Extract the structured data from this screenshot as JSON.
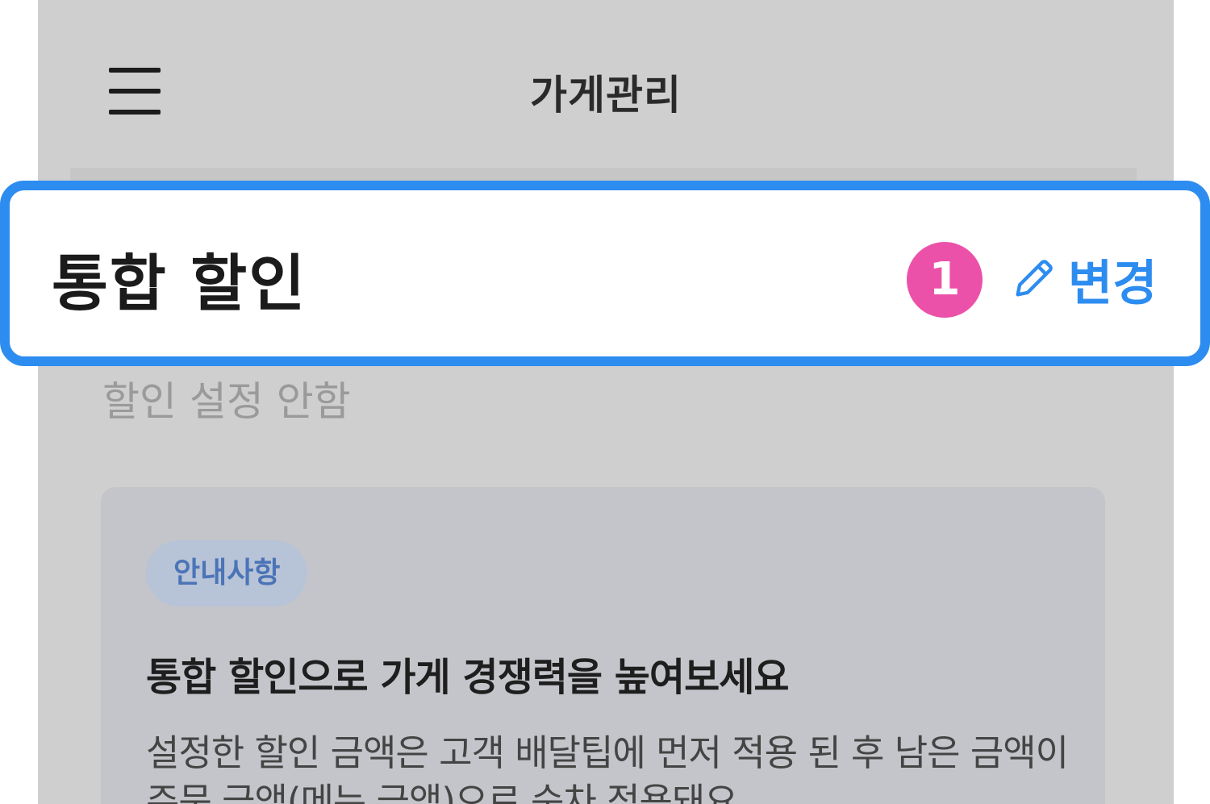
{
  "header": {
    "title": "가게관리"
  },
  "discount": {
    "title": "통합 할인",
    "edit_label": "변경",
    "status": "할인 설정 안함"
  },
  "step": {
    "number": "1"
  },
  "notice": {
    "badge": "안내사항",
    "title": "통합 할인으로 가게 경쟁력을 높여보세요",
    "body": "설정한 할인 금액은 고객 배달팁에 먼저 적용 된 후 남은 금액이 주문 금액(메뉴 금액)으로 순차 적용돼요"
  },
  "colors": {
    "highlight": "#2d8cf0",
    "step_badge": "#ec51a9",
    "overlay": "#cfcfcf",
    "badge_bg": "#b7c3d6",
    "badge_text": "#4b74b8"
  },
  "icons": {
    "menu": "hamburger-icon",
    "edit": "pencil-icon"
  }
}
